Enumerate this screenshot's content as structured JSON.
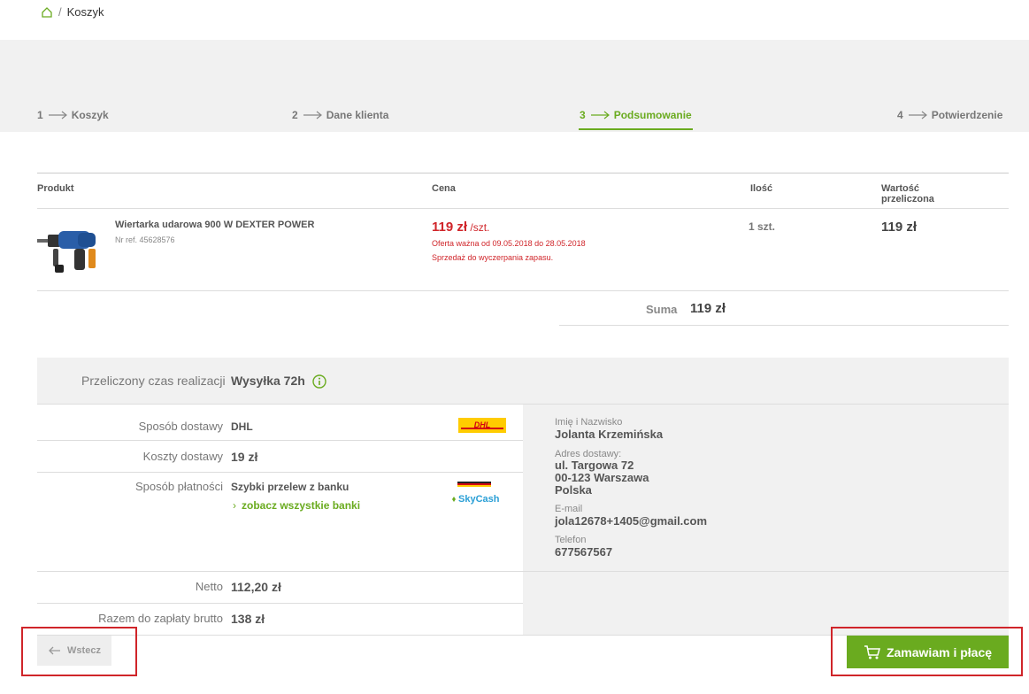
{
  "breadcrumb": {
    "separator": "/",
    "current": "Koszyk"
  },
  "steps": [
    {
      "num": "1",
      "label": "Koszyk"
    },
    {
      "num": "2",
      "label": "Dane klienta"
    },
    {
      "num": "3",
      "label": "Podsumowanie"
    },
    {
      "num": "4",
      "label": "Potwierdzenie"
    }
  ],
  "table": {
    "headers": {
      "product": "Produkt",
      "price": "Cena",
      "qty": "Ilość",
      "value_line1": "Wartość",
      "value_line2": "przeliczona"
    },
    "item": {
      "name": "Wiertarka udarowa 900 W DEXTER POWER",
      "ref": "Nr ref. 45628576",
      "price": "119 zł",
      "price_unit": " /szt.",
      "offer_note": "Oferta ważna od 09.05.2018 do 28.05.2018",
      "stock_note": "Sprzedaż do wyczerpania zapasu.",
      "qty": "1 szt.",
      "total": "119 zł"
    },
    "sum_label": "Suma",
    "sum_value": "119 zł"
  },
  "summary": {
    "realization_label": "Przeliczony czas realizacji",
    "realization_value": "Wysyłka 72h",
    "delivery_label": "Sposób dostawy",
    "delivery_value": "DHL",
    "delivery_cost_label": "Koszty dostawy",
    "delivery_cost_value": "19 zł",
    "payment_label": "Sposób płatności",
    "payment_value": "Szybki przelew z banku",
    "banks_link": "zobacz wszystkie banki",
    "skycash_label": "SkyCash",
    "netto_label": "Netto",
    "netto_value": "112,20 zł",
    "brutto_label": "Razem do zapłaty brutto",
    "brutto_value": "138 zł"
  },
  "customer": {
    "name_label": "Imię i Nazwisko",
    "name_value": "Jolanta Krzemińska",
    "address_label": "Adres dostawy:",
    "address_line1": "ul. Targowa 72",
    "address_line2": "00-123 Warszawa",
    "address_line3": "Polska",
    "email_label": "E-mail",
    "email_value": "jola12678+1405@gmail.com",
    "phone_label": "Telefon",
    "phone_value": "677567567"
  },
  "actions": {
    "back_label": "Wstecz",
    "order_label": "Zamawiam i płacę"
  },
  "colors": {
    "accent": "#6aab1f",
    "price": "#d0252a",
    "highlight": "#d0252a",
    "dhl": "#ffcc00"
  }
}
